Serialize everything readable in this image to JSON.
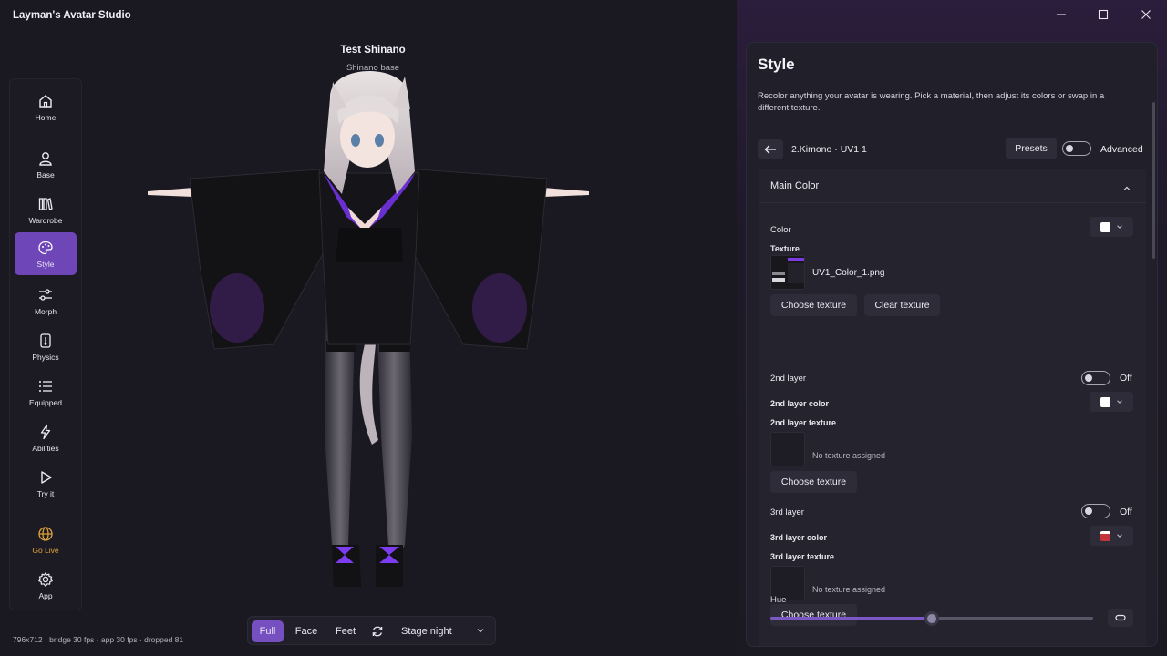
{
  "app": {
    "title": "Layman's Avatar Studio"
  },
  "avatar": {
    "name": "Test Shinano",
    "base": "Shinano base"
  },
  "nav": {
    "items": [
      {
        "label": "Home",
        "icon": "home-icon"
      },
      {
        "label": "Base",
        "icon": "person-icon"
      },
      {
        "label": "Wardrobe",
        "icon": "wardrobe-icon"
      },
      {
        "label": "Style",
        "icon": "palette-icon",
        "active": true
      },
      {
        "label": "Morph",
        "icon": "sliders-icon"
      },
      {
        "label": "Physics",
        "icon": "physics-icon"
      },
      {
        "label": "Equipped",
        "icon": "list-icon"
      },
      {
        "label": "Abilities",
        "icon": "lightning-icon"
      },
      {
        "label": "Try it",
        "icon": "play-icon"
      },
      {
        "label": "Go Live",
        "icon": "globe-icon",
        "color": "#e2a43a"
      },
      {
        "label": "App",
        "icon": "gear-icon"
      }
    ]
  },
  "status": {
    "text": "796x712 · bridge 30 fps · app 30 fps · dropped 81"
  },
  "view_bar": {
    "modes": [
      "Full",
      "Face",
      "Feet"
    ],
    "active_mode": "Full",
    "stage": "Stage night",
    "refresh_icon": "refresh-icon"
  },
  "style_panel": {
    "title": "Style",
    "description": "Recolor anything your avatar is wearing. Pick a material, then adjust its colors or swap in a different texture.",
    "material": "2.Kimono · UV1 1",
    "presets_label": "Presets",
    "advanced_label": "Advanced",
    "section": {
      "title": "Main Color",
      "color_label": "Color",
      "color_value": "#ffffff",
      "texture_label": "Texture",
      "texture_file": "UV1_Color_1.png",
      "choose_texture": "Choose texture",
      "clear_texture": "Clear texture",
      "layer2_label": "2nd layer",
      "layer2_state": "Off",
      "layer2_color_label": "2nd layer color",
      "layer2_color_value": "#ffffff",
      "layer2_texture_label": "2nd layer texture",
      "layer2_texture": "No texture assigned",
      "layer2_choose": "Choose texture",
      "layer3_label": "3rd layer",
      "layer3_state": "Off",
      "layer3_color_label": "3rd layer color",
      "layer3_color_value": "#c4343c",
      "layer3_texture_label": "3rd layer texture",
      "layer3_texture": "No texture assigned",
      "layer3_choose": "Choose texture",
      "hue_label": "Hue",
      "hue_value": 0.5
    }
  },
  "colors": {
    "accent": "#7650c0",
    "go_live": "#e2a43a"
  }
}
